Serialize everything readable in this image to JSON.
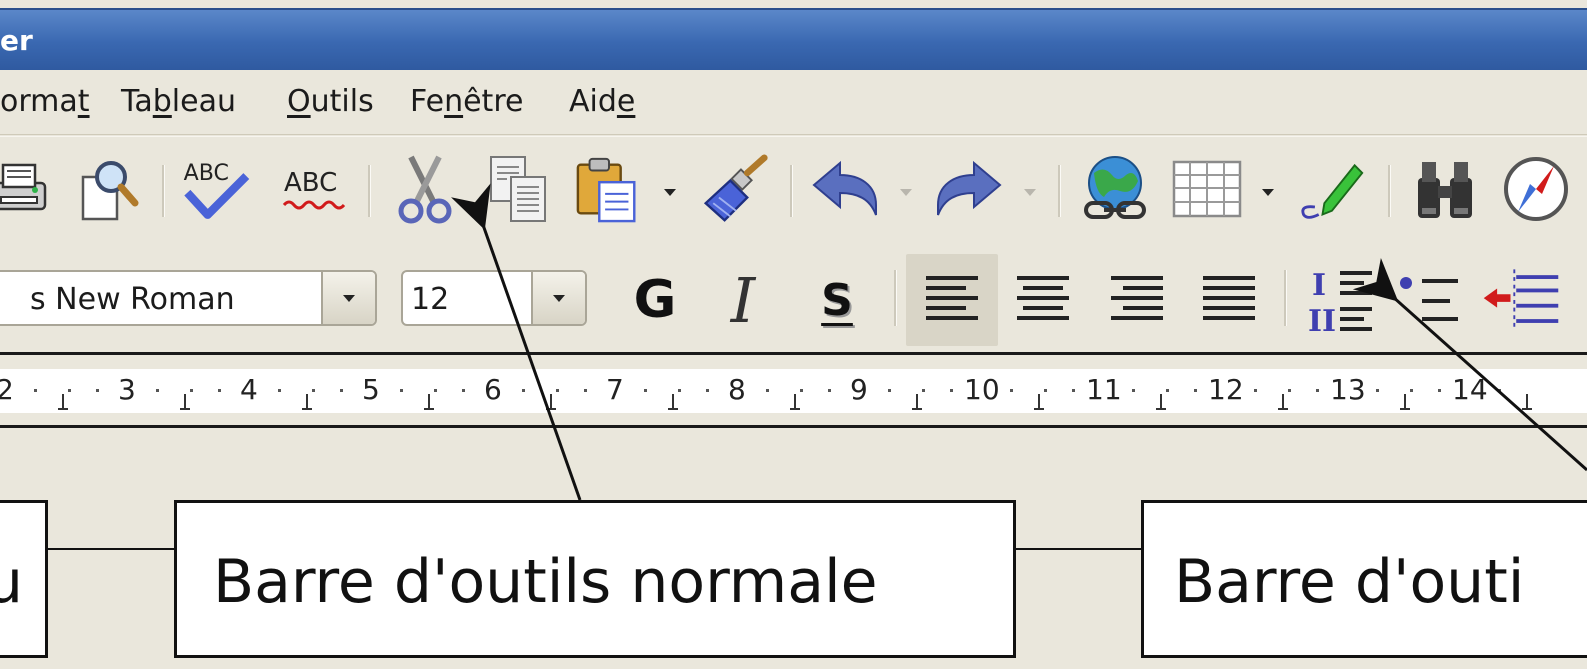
{
  "window": {
    "title_fragment": "er"
  },
  "menubar": {
    "items": [
      {
        "pre": "ormat",
        "mn": "",
        "post": "",
        "full": "ormat"
      },
      {
        "full": "Tableau"
      },
      {
        "full": "Outils"
      },
      {
        "full": "Fenêtre"
      },
      {
        "full": "Aide"
      }
    ],
    "format": {
      "a": "orma",
      "b": "t",
      "c": ""
    },
    "tableau": {
      "a": "Ta",
      "b": "b",
      "c": "leau"
    },
    "outils": {
      "a": "",
      "b": "O",
      "c": "utils"
    },
    "fenetre": {
      "a": "Fe",
      "b": "n",
      "c": "être"
    },
    "aide": {
      "a": "Aid",
      "b": "e",
      "c": ""
    }
  },
  "standard_toolbar": {
    "icons": [
      "print-icon",
      "print-preview-icon",
      "spellcheck-icon",
      "autospellcheck-icon",
      "cut-icon",
      "copy-icon",
      "paste-icon",
      "clone-formatting-icon",
      "undo-icon",
      "redo-icon",
      "hyperlink-icon",
      "table-icon",
      "draw-functions-icon",
      "find-replace-icon",
      "navigator-icon"
    ],
    "spell_label": "ABC",
    "autospell_label": "ABC"
  },
  "formatting_toolbar": {
    "font_name": "s New Roman",
    "font_size": "12",
    "bold_label": "G",
    "italic_label": "I",
    "shadow_label": "S",
    "align_left_pressed": true
  },
  "ruler": {
    "labels": [
      "2",
      "3",
      "4",
      "5",
      "6",
      "7",
      "8",
      "9",
      "10",
      "11",
      "12",
      "13",
      "14"
    ]
  },
  "callouts": {
    "left_fragment": "u",
    "center": "Barre d'outils normale",
    "right_fragment": "Barre d'outi"
  },
  "colors": {
    "titlebar": "#3a68b1",
    "chrome": "#eae7dc",
    "accent_blue": "#3f3fb0",
    "accent_red": "#d11b1b"
  }
}
